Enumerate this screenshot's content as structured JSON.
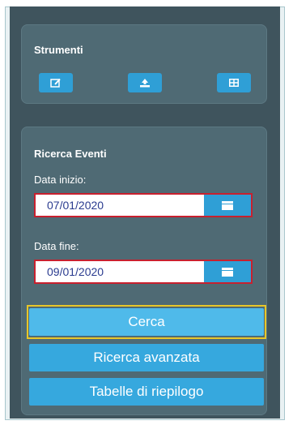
{
  "tools": {
    "title": "Strumenti",
    "buttons": [
      {
        "icon": "edit-icon"
      },
      {
        "icon": "upload-icon"
      },
      {
        "icon": "grid-icon"
      }
    ]
  },
  "search": {
    "title": "Ricerca Eventi",
    "start_label": "Data inizio:",
    "start_value": "07/01/2020",
    "end_label": "Data fine:",
    "end_value": "09/01/2020",
    "search_button": "Cerca",
    "advanced_button": "Ricerca avanzata",
    "summary_button": "Tabelle di riepilogo"
  },
  "colors": {
    "panel": "#3f545d",
    "card": "#4f6a74",
    "button": "#2f9fd6",
    "highlight_red": "#c8202e",
    "highlight_yellow": "#e8c628"
  }
}
